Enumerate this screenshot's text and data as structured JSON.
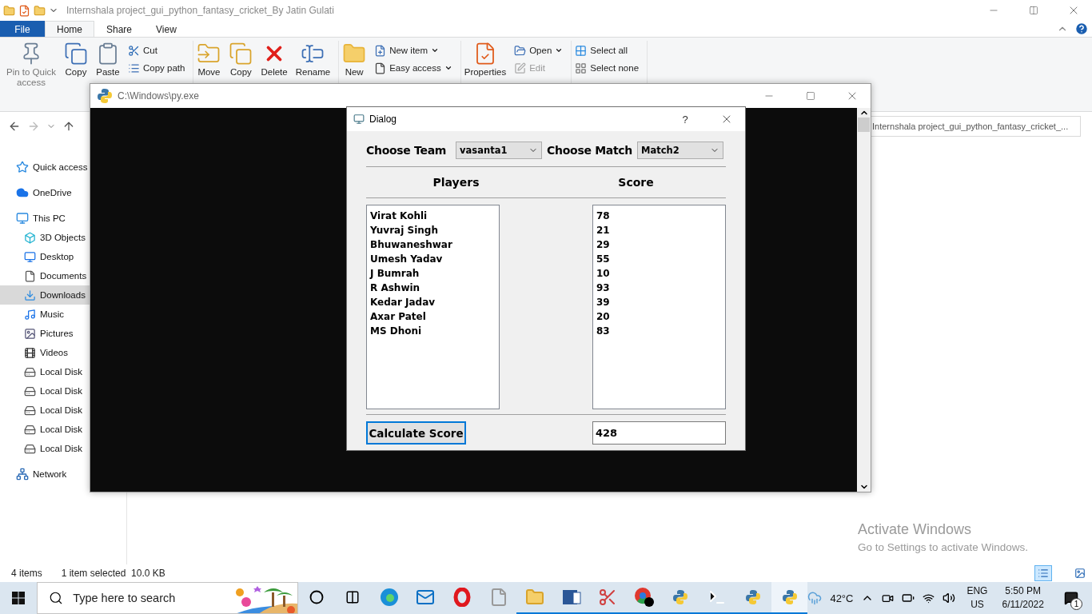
{
  "explorer": {
    "title": "Internshala project_gui_python_fantasy_cricket_By Jatin Gulati",
    "tabs": [
      {
        "label": "File",
        "kind": "file",
        "selected": false
      },
      {
        "label": "Home",
        "kind": "tab",
        "selected": true
      },
      {
        "label": "Share",
        "kind": "tab",
        "selected": false
      },
      {
        "label": "View",
        "kind": "tab",
        "selected": false
      }
    ],
    "ribbon": [
      {
        "large": [
          {
            "label": "Pin to Quick access",
            "disabled": true
          },
          {
            "label": "Copy",
            "disabled": false
          },
          {
            "label": "Paste",
            "disabled": false
          }
        ],
        "small": [
          {
            "label": "Cut",
            "menu": false,
            "disabled": false
          },
          {
            "label": "Copy path",
            "menu": false,
            "disabled": false
          }
        ]
      },
      {
        "large": [
          {
            "label": "Move",
            "disabled": false
          },
          {
            "label": "Copy",
            "disabled": false
          },
          {
            "label": "Delete",
            "disabled": false
          },
          {
            "label": "Rename",
            "disabled": false
          }
        ]
      },
      {
        "large": [
          {
            "label": "New",
            "disabled": false
          }
        ],
        "small": [
          {
            "label": "New item",
            "menu": true,
            "disabled": false
          },
          {
            "label": "Easy access",
            "menu": true,
            "disabled": false
          }
        ]
      },
      {
        "large": [
          {
            "label": "Properties",
            "disabled": false
          }
        ],
        "small": [
          {
            "label": "Open",
            "menu": true,
            "disabled": false
          },
          {
            "label": "Edit",
            "menu": false,
            "disabled": true
          }
        ]
      },
      {
        "small": [
          {
            "label": "Select all",
            "menu": false,
            "disabled": false
          },
          {
            "label": "Select none",
            "menu": false,
            "disabled": false
          }
        ]
      }
    ],
    "search_field": "Internshala project_gui_python_fantasy_cricket_...",
    "sidebar": [
      {
        "label": "Quick access",
        "selected": false
      },
      {
        "label": "OneDrive",
        "selected": false
      },
      {
        "label": "This PC",
        "selected": false,
        "children": [
          {
            "label": "3D Objects",
            "selected": false
          },
          {
            "label": "Desktop",
            "selected": false
          },
          {
            "label": "Documents",
            "selected": false
          },
          {
            "label": "Downloads",
            "selected": true
          },
          {
            "label": "Music",
            "selected": false
          },
          {
            "label": "Pictures",
            "selected": false
          },
          {
            "label": "Videos",
            "selected": false
          },
          {
            "label": "Local Disk",
            "selected": false
          },
          {
            "label": "Local Disk",
            "selected": false
          },
          {
            "label": "Local Disk",
            "selected": false
          },
          {
            "label": "Local Disk",
            "selected": false
          },
          {
            "label": "Local Disk",
            "selected": false
          }
        ]
      },
      {
        "label": "Network",
        "selected": false
      }
    ],
    "status_bar": {
      "count": "4 items",
      "selection": "1 item selected  10.0 KB"
    }
  },
  "console": {
    "title": "C:\\Windows\\py.exe"
  },
  "dialog": {
    "title": "Dialog",
    "help": "?",
    "team_label": "Choose Team",
    "team": "vasanta1",
    "match_label": "Choose Match",
    "match": "Match2",
    "columns": [
      "Players",
      "Score"
    ],
    "players": [
      "Virat Kohli",
      "Yuvraj Singh",
      "Bhuwaneshwar",
      "Umesh Yadav",
      "J Bumrah",
      "R Ashwin",
      "Kedar Jadav",
      "Axar Patel",
      "MS Dhoni"
    ],
    "scores": [
      "78",
      "21",
      "29",
      "55",
      "10",
      "93",
      "39",
      "20",
      "83"
    ],
    "button": "Calculate Score",
    "total": "428"
  },
  "activation": {
    "title": "Activate Windows",
    "subtitle": "Go to Settings to activate Windows."
  },
  "taskbar": {
    "search_placeholder": "Type here to search",
    "apps": [
      {
        "running": false,
        "active": false
      },
      {
        "running": false,
        "active": false
      },
      {
        "running": false,
        "active": false
      },
      {
        "running": false,
        "active": false
      },
      {
        "running": true,
        "active": false
      },
      {
        "running": true,
        "active": false
      },
      {
        "running": true,
        "active": false
      },
      {
        "running": true,
        "active": false
      },
      {
        "running": true,
        "active": false
      },
      {
        "running": true,
        "active": false
      },
      {
        "running": true,
        "active": false
      },
      {
        "running": true,
        "active": true
      }
    ],
    "temperature": "42°C",
    "language": "ENG",
    "region": "US",
    "time": "5:50 PM",
    "date": "6/11/2022",
    "notifications": "1"
  }
}
